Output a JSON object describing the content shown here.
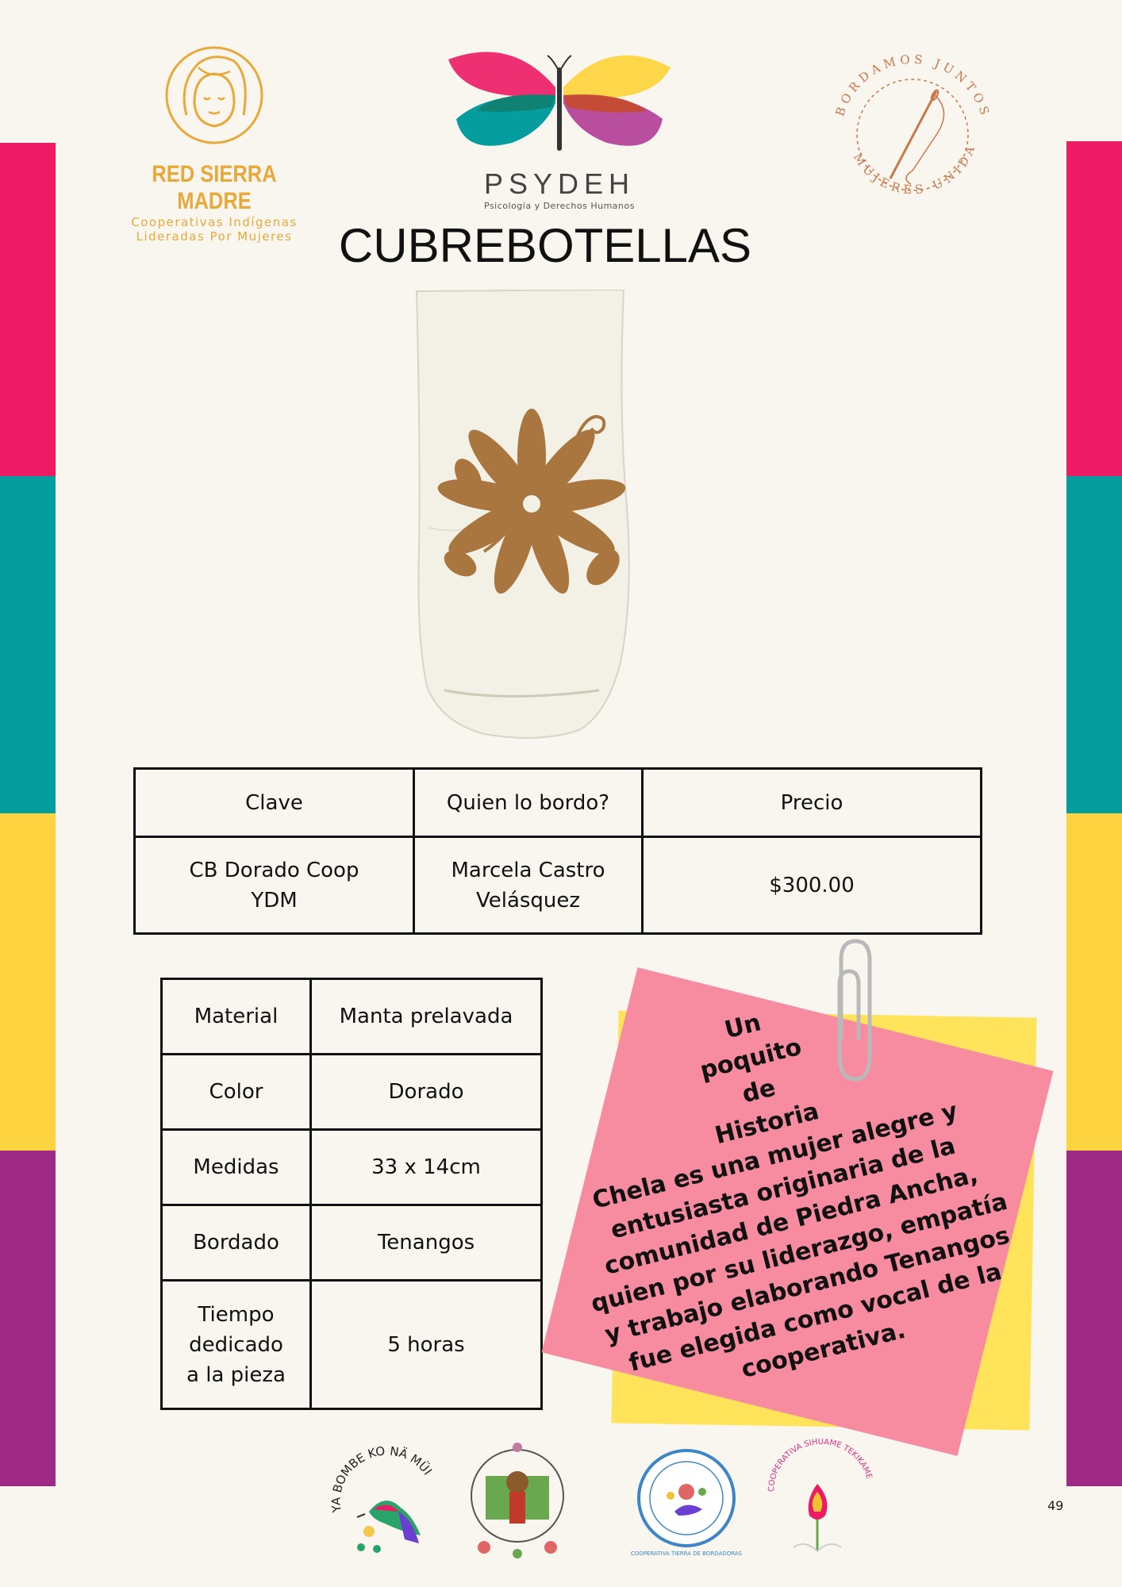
{
  "colors": {
    "magenta": "#ec1b64",
    "teal": "#069d9f",
    "yellow": "#fdd440",
    "purple": "#9e2a85",
    "gold": "#e8a93a",
    "embroidery": "#a9763f"
  },
  "logos": {
    "red_sierra_madre": {
      "name": "RED SIERRA MADRE",
      "line1": "Cooperativas Indígenas",
      "line2": "Lideradas Por Mujeres"
    },
    "psydeh": {
      "name": "PSYDEH",
      "subtitle": "Psicología y Derechos Humanos"
    },
    "bordamos": {
      "text_top": "BORDAMOS JUNTOS",
      "text_bottom": "MUJERES UNIDAS"
    },
    "bottom": {
      "ya_bombe": "YA BOMBE KO NÄ MÜI",
      "tierra": "COOPERATIVA TIERRA DE BORDADORAS",
      "sihuame": "COOPERATIVA SIHUAME TEKIKAME"
    }
  },
  "title": "CUBREBOTELLAS",
  "main_table": {
    "headers": [
      "Clave",
      "Quien lo bordo?",
      "Precio"
    ],
    "row": [
      "CB Dorado Coop YDM",
      "Marcela Castro Velásquez",
      "$300.00"
    ]
  },
  "spec_table": [
    {
      "label": "Material",
      "value": "Manta prelavada"
    },
    {
      "label": "Color",
      "value": "Dorado"
    },
    {
      "label": "Medidas",
      "value": "33 x 14cm"
    },
    {
      "label": "Bordado",
      "value": "Tenangos"
    },
    {
      "label": "Tiempo dedicado a la pieza",
      "value": "5 horas"
    }
  ],
  "note": {
    "heading": "Un poquito de Historia",
    "body": "Chela es una mujer alegre y entusiasta originaria de la comunidad de Piedra Ancha, quien por su liderazgo, empatía y trabajo elaborando Tenangos  fue elegida como vocal de la cooperativa."
  },
  "page_number": "49"
}
